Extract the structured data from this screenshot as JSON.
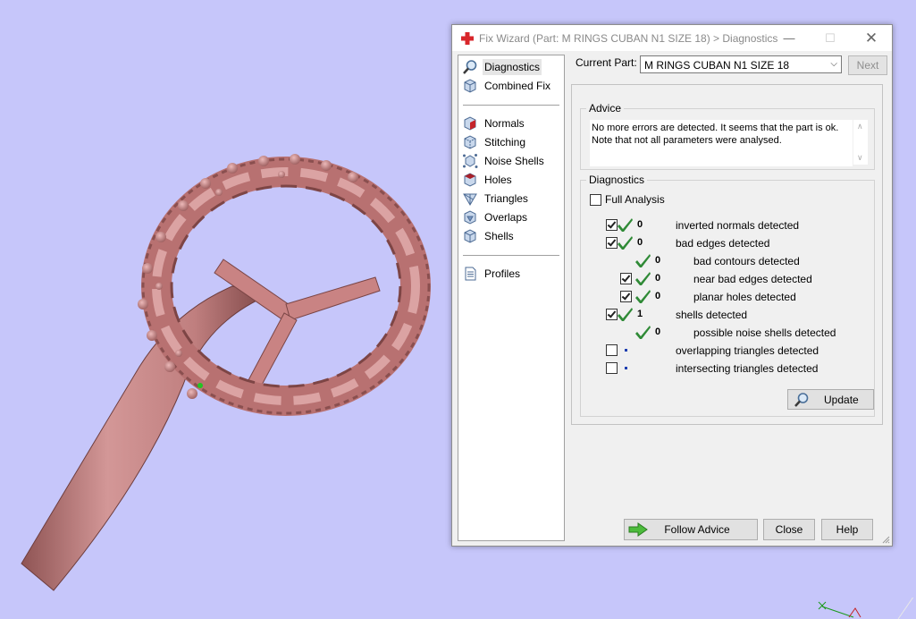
{
  "window": {
    "title": "Fix Wizard (Part: M RINGS CUBAN N1 SIZE 18) > Diagnostics",
    "minimize_symbol": "—",
    "maximize_symbol": "☐",
    "close_symbol": "✕"
  },
  "nav": {
    "items": [
      {
        "label": "Diagnostics",
        "icon": "magnifier-icon"
      },
      {
        "label": "Combined Fix",
        "icon": "cube-icon"
      },
      {
        "label": "Normals",
        "icon": "normals-cube-icon"
      },
      {
        "label": "Stitching",
        "icon": "stitching-cube-icon"
      },
      {
        "label": "Noise Shells",
        "icon": "noise-shells-icon"
      },
      {
        "label": "Holes",
        "icon": "holes-cube-icon"
      },
      {
        "label": "Triangles",
        "icon": "triangles-icon"
      },
      {
        "label": "Overlaps",
        "icon": "overlaps-cube-icon"
      },
      {
        "label": "Shells",
        "icon": "shells-cube-icon"
      },
      {
        "label": "Profiles",
        "icon": "document-icon"
      }
    ],
    "selected": "Diagnostics"
  },
  "current_part": {
    "label": "Current Part:",
    "value": "M RINGS CUBAN N1 SIZE 18",
    "next_label": "Next"
  },
  "advice": {
    "title": "Advice",
    "line1": "No more errors are detected. It seems that the part is ok.",
    "line2": "Note that not all parameters were analysed."
  },
  "diagnostics": {
    "title": "Diagnostics",
    "full_analysis_label": "Full Analysis",
    "full_analysis_checked": false,
    "rows": [
      {
        "checkbox": true,
        "checked": true,
        "status": "ok",
        "count": "0",
        "label": "inverted normals detected"
      },
      {
        "checkbox": true,
        "checked": true,
        "status": "ok",
        "count": "0",
        "label": "bad edges detected"
      },
      {
        "checkbox": false,
        "checked": false,
        "status": "ok",
        "count": "0",
        "label": "bad contours detected"
      },
      {
        "checkbox": true,
        "checked": true,
        "status": "ok",
        "count": "0",
        "label": "near bad edges detected"
      },
      {
        "checkbox": true,
        "checked": true,
        "status": "ok",
        "count": "0",
        "label": "planar holes detected"
      },
      {
        "checkbox": true,
        "checked": true,
        "status": "ok",
        "count": "1",
        "label": "shells detected"
      },
      {
        "checkbox": false,
        "checked": false,
        "status": "ok",
        "count": "0",
        "label": "possible noise shells detected"
      },
      {
        "checkbox": true,
        "checked": false,
        "status": "none",
        "count": "",
        "label": "overlapping triangles detected"
      },
      {
        "checkbox": true,
        "checked": false,
        "status": "none",
        "count": "",
        "label": "intersecting triangles detected"
      }
    ],
    "update_label": "Update"
  },
  "buttons": {
    "follow_advice": "Follow Advice",
    "close": "Close",
    "help": "Help"
  },
  "colors": {
    "viewport_background": "#c6c6fa",
    "model": "#c98383",
    "tick_green": "#2f8a36"
  }
}
